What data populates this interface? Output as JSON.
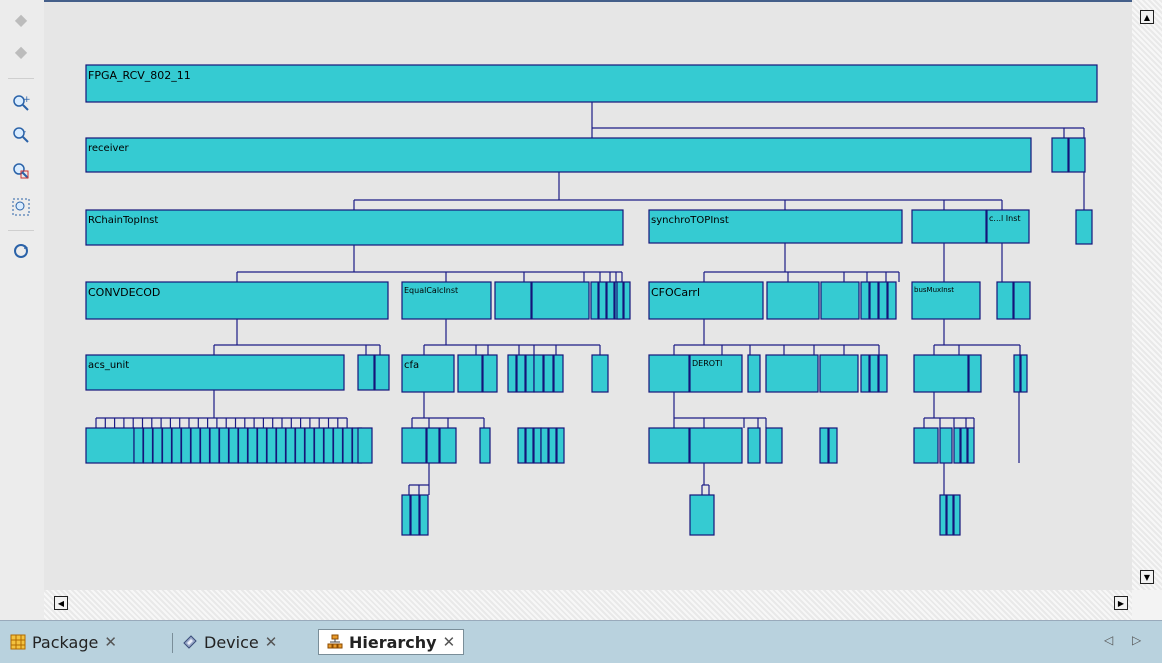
{
  "toolbar": {
    "items": [
      "back-arrow-icon",
      "forward-arrow-icon",
      "zoom-in-icon",
      "zoom-out-icon",
      "zoom-select-icon",
      "zoom-fit-icon",
      "refresh-icon"
    ]
  },
  "hierarchy": {
    "labels": {
      "top": "FPGA_RCV_802_11",
      "receiver": "receiver",
      "rchain": "RChainTopInst",
      "synchro": "synchroTOPInst",
      "convdecod": "CONVDECOD",
      "acs": "acs_unit",
      "equal": "EqualCalcInst",
      "cfo": "CFOCarrl",
      "cfa": "cfa",
      "derot": "DEROTI",
      "bus": "busMuxInst",
      "syn_a": "",
      "syn_b": "c...l Inst"
    },
    "colors": {
      "fill": "#35cbd2",
      "stroke": "#15157a",
      "line": "#1c1c86"
    }
  },
  "tabs": [
    {
      "label": "Package",
      "close": "✕"
    },
    {
      "label": "Device",
      "close": "✕"
    },
    {
      "label": "Hierarchy",
      "close": "✕"
    }
  ],
  "nav": {
    "prev": "◁",
    "next": "▷"
  }
}
